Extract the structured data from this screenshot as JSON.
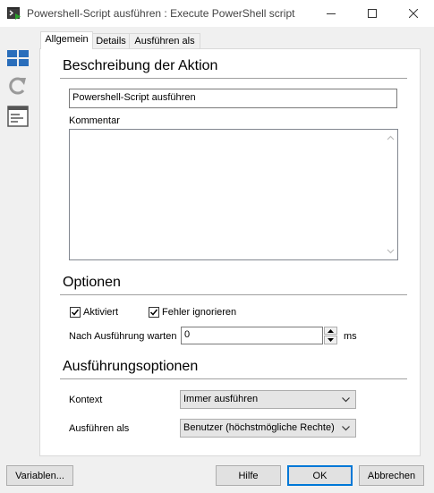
{
  "window": {
    "title": "Powershell-Script ausführen : Execute PowerShell script"
  },
  "tabs": [
    {
      "label": "Allgemein",
      "active": true
    },
    {
      "label": "Details",
      "active": false
    },
    {
      "label": "Ausführen als",
      "active": false
    }
  ],
  "description": {
    "section_title": "Beschreibung der Aktion",
    "name_value": "Powershell-Script ausführen",
    "comment_label": "Kommentar",
    "comment_value": ""
  },
  "options": {
    "section_title": "Optionen",
    "activated_label": "Aktiviert",
    "activated_checked": true,
    "ignore_errors_label": "Fehler ignorieren",
    "ignore_errors_checked": true,
    "wait_label": "Nach Ausführung warten",
    "wait_value": "0",
    "wait_unit": "ms"
  },
  "exec_options": {
    "section_title": "Ausführungsoptionen",
    "context_label": "Kontext",
    "context_value": "Immer ausführen",
    "run_as_label": "Ausführen als",
    "run_as_value": "Benutzer (höchstmögliche Rechte)"
  },
  "footer": {
    "variables_label": "Variablen...",
    "help_label": "Hilfe",
    "ok_label": "OK",
    "cancel_label": "Abbrechen"
  },
  "colors": {
    "accent": "#0078d7",
    "window_bg": "#f0f0f0",
    "icon_blue": "#2a6ebb"
  },
  "icons": [
    "powershell-app-icon",
    "minimize-icon",
    "maximize-icon",
    "close-icon",
    "layout-grid-icon",
    "refresh-icon",
    "list-view-icon",
    "checkmark-icon",
    "chevron-down-icon",
    "spin-up-icon",
    "spin-down-icon",
    "scroll-up-icon",
    "scroll-down-icon"
  ]
}
